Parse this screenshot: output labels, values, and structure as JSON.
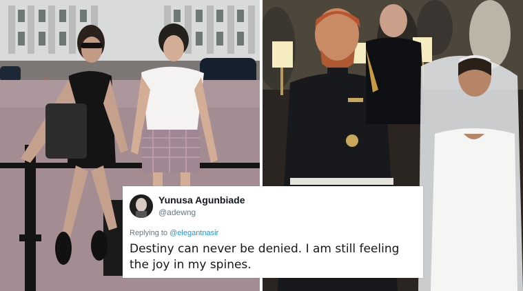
{
  "photos": {
    "left_description_icon": "vintage-photo-icon",
    "right_description_icon": "wedding-photo-icon"
  },
  "tweet": {
    "display_name": "Yunusa Agunbiade",
    "handle": "@adewng",
    "reply_prefix": "Replying to",
    "reply_to": "@elegantnasir",
    "text": "Destiny can never be denied. I am still feeling the joy in my spines.",
    "text_color": "#14171a",
    "link_color": "#1b95e0",
    "muted_color": "#657786"
  }
}
